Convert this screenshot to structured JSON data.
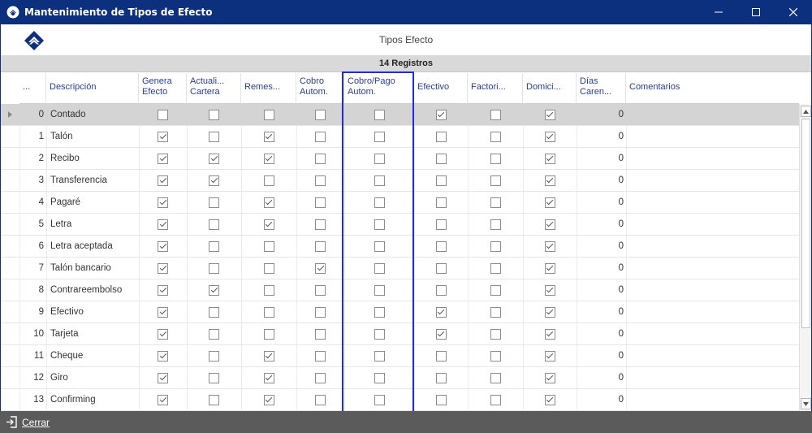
{
  "window": {
    "title": "Mantenimiento de Tipos de Efecto",
    "icon": "app-logo-icon",
    "controls": [
      "minimize-icon",
      "maximize-icon",
      "close-icon"
    ]
  },
  "header": {
    "title": "Tipos Efecto",
    "logo": "company-logo-icon"
  },
  "grid": {
    "record_count": "14 Registros",
    "columns": [
      {
        "label": "...",
        "label2": ""
      },
      {
        "label": "Descripción",
        "label2": ""
      },
      {
        "label": "Genera",
        "label2": "Efecto"
      },
      {
        "label": "Actuali...",
        "label2": "Cartera"
      },
      {
        "label": "Remes...",
        "label2": ""
      },
      {
        "label": "Cobro",
        "label2": "Autom."
      },
      {
        "label": "Cobro/Pago",
        "label2": "Autom."
      },
      {
        "label": "Efectivo",
        "label2": ""
      },
      {
        "label": "Factori...",
        "label2": ""
      },
      {
        "label": "Domici...",
        "label2": ""
      },
      {
        "label": "Días",
        "label2": "Caren..."
      },
      {
        "label": "Comentarios",
        "label2": ""
      }
    ],
    "rows": [
      {
        "id": "0",
        "desc": "Contado",
        "checks": [
          false,
          false,
          false,
          false,
          false,
          true,
          false,
          true
        ],
        "dias": "0",
        "comentarios": ""
      },
      {
        "id": "1",
        "desc": "Talón",
        "checks": [
          true,
          false,
          true,
          false,
          false,
          false,
          false,
          true
        ],
        "dias": "0",
        "comentarios": ""
      },
      {
        "id": "2",
        "desc": "Recibo",
        "checks": [
          true,
          true,
          true,
          false,
          false,
          false,
          false,
          true
        ],
        "dias": "0",
        "comentarios": ""
      },
      {
        "id": "3",
        "desc": "Transferencia",
        "checks": [
          true,
          true,
          false,
          false,
          false,
          false,
          false,
          true
        ],
        "dias": "0",
        "comentarios": ""
      },
      {
        "id": "4",
        "desc": "Pagaré",
        "checks": [
          true,
          false,
          true,
          false,
          false,
          false,
          false,
          true
        ],
        "dias": "0",
        "comentarios": ""
      },
      {
        "id": "5",
        "desc": "Letra",
        "checks": [
          true,
          false,
          true,
          false,
          false,
          false,
          false,
          true
        ],
        "dias": "0",
        "comentarios": ""
      },
      {
        "id": "6",
        "desc": "Letra aceptada",
        "checks": [
          true,
          false,
          false,
          false,
          false,
          false,
          false,
          true
        ],
        "dias": "0",
        "comentarios": ""
      },
      {
        "id": "7",
        "desc": "Talón bancario",
        "checks": [
          true,
          false,
          false,
          true,
          false,
          false,
          false,
          true
        ],
        "dias": "0",
        "comentarios": ""
      },
      {
        "id": "8",
        "desc": "Contrareembolso",
        "checks": [
          true,
          true,
          false,
          false,
          false,
          false,
          false,
          true
        ],
        "dias": "0",
        "comentarios": ""
      },
      {
        "id": "9",
        "desc": "Efectivo",
        "checks": [
          true,
          false,
          false,
          false,
          false,
          true,
          false,
          true
        ],
        "dias": "0",
        "comentarios": ""
      },
      {
        "id": "10",
        "desc": "Tarjeta",
        "checks": [
          true,
          false,
          false,
          false,
          false,
          true,
          false,
          true
        ],
        "dias": "0",
        "comentarios": ""
      },
      {
        "id": "11",
        "desc": "Cheque",
        "checks": [
          true,
          false,
          true,
          false,
          false,
          false,
          false,
          true
        ],
        "dias": "0",
        "comentarios": ""
      },
      {
        "id": "12",
        "desc": "Giro",
        "checks": [
          true,
          false,
          true,
          false,
          false,
          false,
          false,
          true
        ],
        "dias": "0",
        "comentarios": ""
      },
      {
        "id": "13",
        "desc": "Confirming",
        "checks": [
          true,
          false,
          true,
          false,
          false,
          false,
          false,
          true
        ],
        "dias": "0",
        "comentarios": ""
      }
    ],
    "selected_row": 0
  },
  "footer": {
    "close_label": "Cerrar",
    "close_icon": "exit-icon"
  },
  "colors": {
    "titlebar": "#0c2f7e",
    "header_text": "#2a3d8f",
    "highlight": "#1f29e6",
    "footer": "#5b5b5b"
  }
}
